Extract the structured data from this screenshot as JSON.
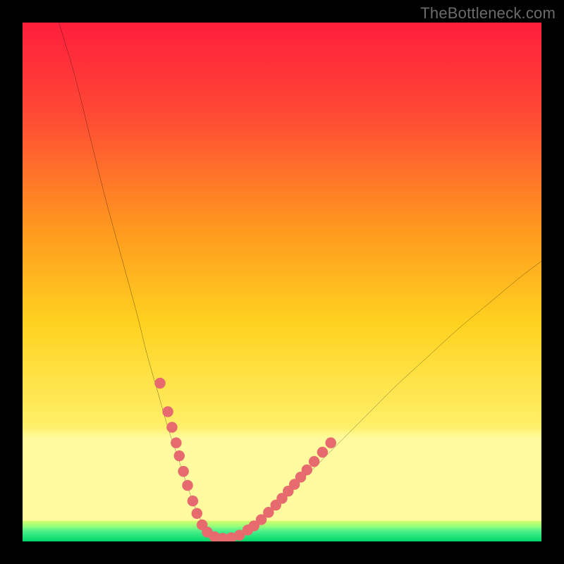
{
  "watermark": "TheBottleneck.com",
  "colors": {
    "frame": "#000000",
    "gradient_top": "#ff1e3c",
    "gradient_mid_upper": "#ff7a2a",
    "gradient_mid": "#ffd21f",
    "gradient_lower": "#fff58a",
    "gradient_green_top": "#d9ff6e",
    "gradient_green_bottom": "#00d66b",
    "curve": "#000000",
    "dots": "#e76a6f"
  },
  "chart_data": {
    "type": "line",
    "title": "",
    "xlabel": "",
    "ylabel": "",
    "xlim": [
      0,
      100
    ],
    "ylim": [
      0,
      100
    ],
    "series": [
      {
        "name": "bottleneck-curve",
        "x": [
          7,
          10,
          13,
          16,
          19,
          22,
          24,
          26,
          28,
          30,
          32,
          33.5,
          35,
          36.5,
          38,
          40,
          44,
          48,
          52,
          56,
          60,
          66,
          72,
          78,
          84,
          90,
          96,
          100
        ],
        "y": [
          100,
          90,
          78,
          66,
          55,
          44,
          36,
          29,
          22,
          16,
          10,
          6,
          3,
          1.2,
          0.5,
          0.6,
          2.5,
          6,
          10,
          14,
          18,
          24,
          30,
          35.5,
          41,
          46,
          51,
          54
        ]
      }
    ],
    "scatter": [
      {
        "name": "curve-dots",
        "points": [
          [
            26.5,
            30.5
          ],
          [
            28,
            25
          ],
          [
            28.8,
            22
          ],
          [
            29.6,
            19
          ],
          [
            30.2,
            16.5
          ],
          [
            31,
            13.5
          ],
          [
            31.8,
            10.8
          ],
          [
            32.8,
            7.8
          ],
          [
            33.6,
            5.4
          ],
          [
            34.6,
            3.2
          ],
          [
            35.6,
            1.8
          ],
          [
            37,
            0.9
          ],
          [
            38.6,
            0.6
          ],
          [
            40.2,
            0.7
          ],
          [
            41.8,
            1.2
          ],
          [
            43.4,
            2.2
          ],
          [
            44.6,
            3
          ],
          [
            46,
            4.2
          ],
          [
            47.4,
            5.6
          ],
          [
            48.8,
            7
          ],
          [
            50,
            8.3
          ],
          [
            51.2,
            9.7
          ],
          [
            52.4,
            11
          ],
          [
            53.6,
            12.4
          ],
          [
            54.8,
            13.8
          ],
          [
            56.2,
            15.4
          ],
          [
            57.8,
            17.2
          ],
          [
            59.4,
            19
          ]
        ]
      }
    ],
    "bands": [
      {
        "name": "lower-highlight",
        "y0": 0,
        "y1": 20
      },
      {
        "name": "green-zone",
        "y0": 0,
        "y1": 4
      }
    ]
  }
}
